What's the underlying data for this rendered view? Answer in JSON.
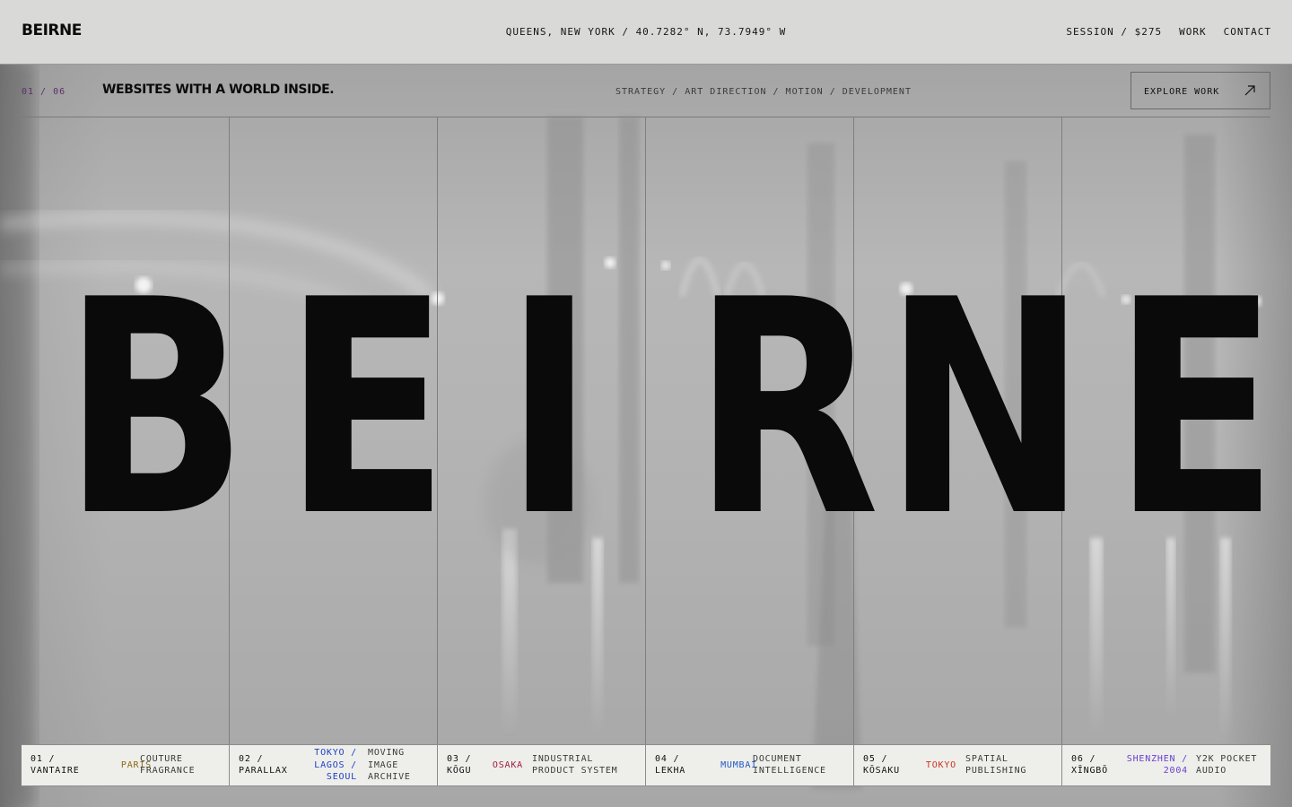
{
  "header": {
    "logo": "BEIRNE",
    "location": "QUEENS, NEW YORK / 40.7282° N, 73.7949° W",
    "nav": {
      "session": "SESSION / $275",
      "work": "WORK",
      "contact": "CONTACT"
    }
  },
  "subbar": {
    "counter": "01 / 06",
    "tagline": "WEBSITES WITH A WORLD INSIDE.",
    "services": "STRATEGY / ART DIRECTION / MOTION / DEVELOPMENT",
    "explore_label": "EXPLORE WORK",
    "explore_icon": "arrow-up-right-icon"
  },
  "hero": {
    "letters": [
      "B",
      "E",
      "I",
      "R",
      "N",
      "E"
    ]
  },
  "projects": [
    {
      "num": "01 /",
      "name": "VANTAIRE",
      "city": [
        "PARIS"
      ],
      "city_color": "#8a6a10",
      "desc": [
        "COUTURE",
        "FRAGRANCE"
      ]
    },
    {
      "num": "02 /",
      "name": "PARALLAX",
      "city": [
        "TOKYO /",
        "LAGOS /",
        "SEOUL"
      ],
      "city_color": "#1b3fc4",
      "desc": [
        "MOVING",
        "IMAGE",
        "ARCHIVE"
      ]
    },
    {
      "num": "03 /",
      "name": "KŌGU",
      "city": [
        "OSAKA"
      ],
      "city_color": "#a01c3c",
      "desc": [
        "INDUSTRIAL",
        "PRODUCT SYSTEM"
      ]
    },
    {
      "num": "04 /",
      "name": "LEKHA",
      "city": [
        "MUMBAI"
      ],
      "city_color": "#1f58c8",
      "desc": [
        "DOCUMENT",
        "INTELLIGENCE"
      ]
    },
    {
      "num": "05 /",
      "name": "KŌSAKU",
      "city": [
        "TOKYO"
      ],
      "city_color": "#c8341c",
      "desc": [
        "SPATIAL",
        "PUBLISHING"
      ]
    },
    {
      "num": "06 /",
      "name": "XĪNGBŌ",
      "city": [
        "SHENZHEN /",
        "2004"
      ],
      "city_color": "#6a3fd0",
      "desc": [
        "Y2K POCKET",
        "AUDIO"
      ]
    }
  ]
}
